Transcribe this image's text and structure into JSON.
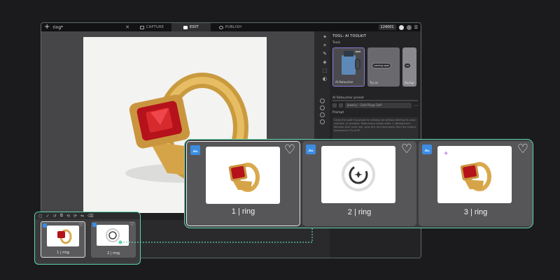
{
  "topbar": {
    "file_name": "ring*",
    "tabs": [
      {
        "label": "CAPTURE"
      },
      {
        "label": "EDIT"
      },
      {
        "label": "PUBLISH"
      }
    ],
    "credits": "124001"
  },
  "panel": {
    "title": "TOOL: AI TOOLKIT",
    "tools_label": "Tools",
    "cards": [
      {
        "label": "AI Retoucher",
        "badge": "NEW"
      },
      {
        "label": "Try-on",
        "status": "coming soon"
      },
      {
        "label": "Backgr",
        "status": "co"
      }
    ],
    "preset_label": "AI Retoucher preset",
    "preset_value": "Jewelry - Gold Rings Soft",
    "prompt_label": "Prompt",
    "prompt_text": "Clean this gold ring photo for catalog use without altering its color, contrast, or shadows. Make these visible edits: 1. Background: Remove dust, knitz mar, gray tint, and dust specs from the surface background. Fix SOFT"
  },
  "mini_strip": {
    "items": [
      {
        "label": "1 | ring"
      },
      {
        "label": "2 | ring"
      }
    ]
  },
  "big_strip": {
    "items": [
      {
        "label": "1 | ring"
      },
      {
        "label": "2 | ring"
      },
      {
        "label": "3 | ring"
      }
    ]
  },
  "colors": {
    "accent": "#5fd4a9",
    "selection": "#8a7bd8",
    "badge_blue": "#3d8ce0",
    "ring_gold": "#d9a94e",
    "ruby": "#b5121b"
  }
}
